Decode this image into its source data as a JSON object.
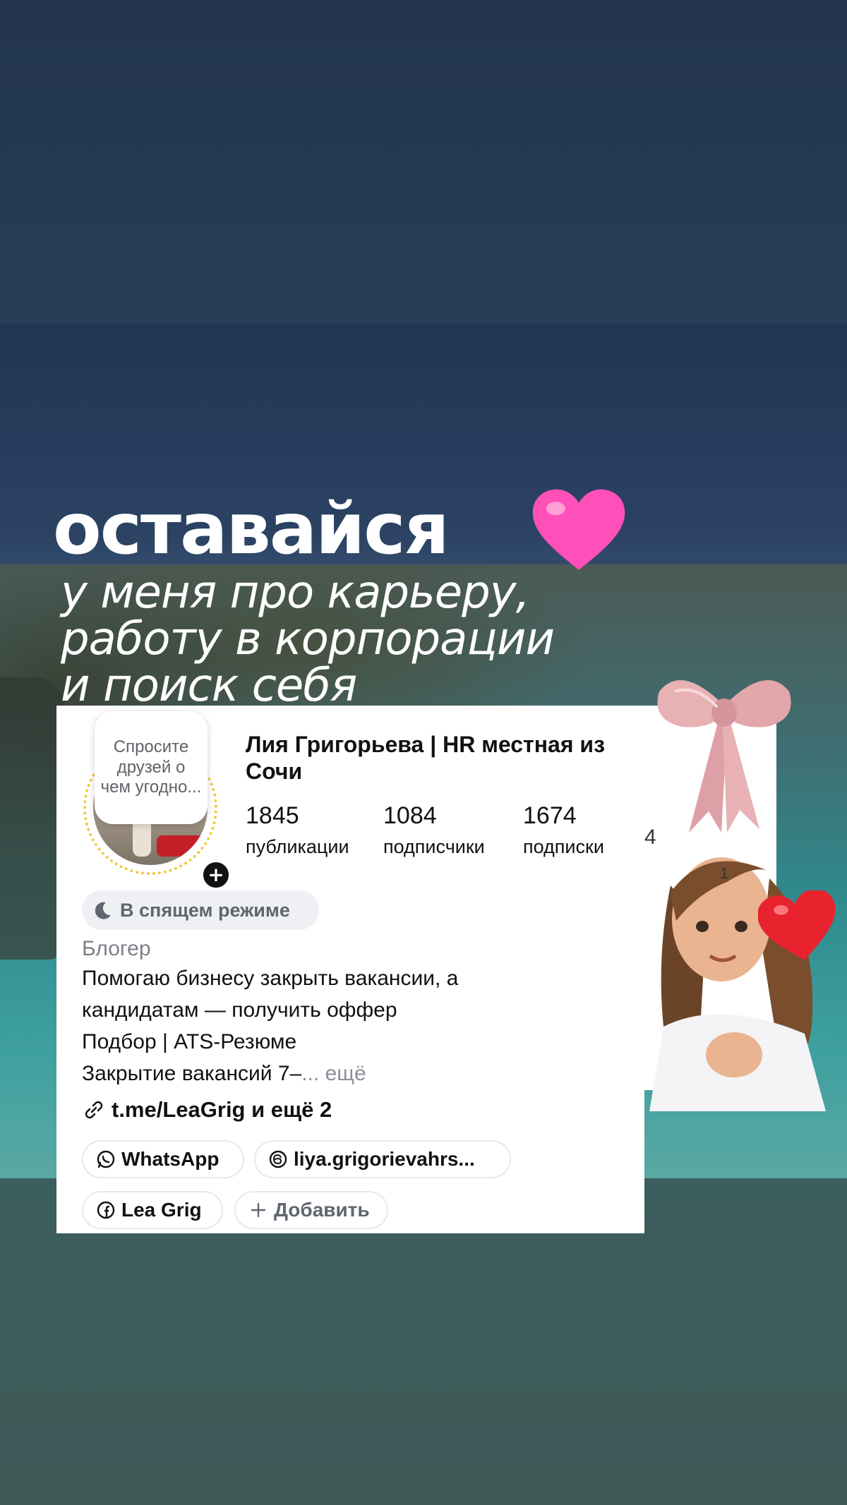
{
  "story": {
    "heading": "оставайся",
    "subtitle_lines": [
      "у меня про карьеру,",
      "работу в корпорации",
      "и поиск себя"
    ]
  },
  "profile": {
    "note": "Спросите друзей о чем угодно...",
    "name": "Лия Григорьева | HR местная из Сочи",
    "stats": [
      {
        "value": "1845",
        "label": "публикации"
      },
      {
        "value": "1084",
        "label": "подписчики"
      },
      {
        "value": "1674",
        "label": "подписки"
      }
    ],
    "status": "В спящем режиме",
    "category": "Блогер",
    "bio_lines": [
      "Помогаю бизнесу закрыть вакансии, а",
      "кандидатам — получить оффер",
      "Подбор  |  ATS-Резюме",
      "Закрытие вакансий 7–"
    ],
    "bio_more": "... ещё",
    "link": "t.me/LeaGrig и ещё 2",
    "chips": [
      {
        "label": "WhatsApp",
        "icon": "whatsapp-icon"
      },
      {
        "label": "liya.grigorievahrs...",
        "icon": "threads-icon"
      },
      {
        "label": "Lea Grig",
        "icon": "facebook-icon"
      },
      {
        "label": "Добавить",
        "icon": "plus-icon"
      }
    ],
    "stray": [
      "4",
      "1"
    ]
  },
  "colors": {
    "heart_pink": "#ff4fb8",
    "heart_red": "#e8232e",
    "bow_pink": "#e8b1b4",
    "ring_yellow": "#f0c93a"
  }
}
